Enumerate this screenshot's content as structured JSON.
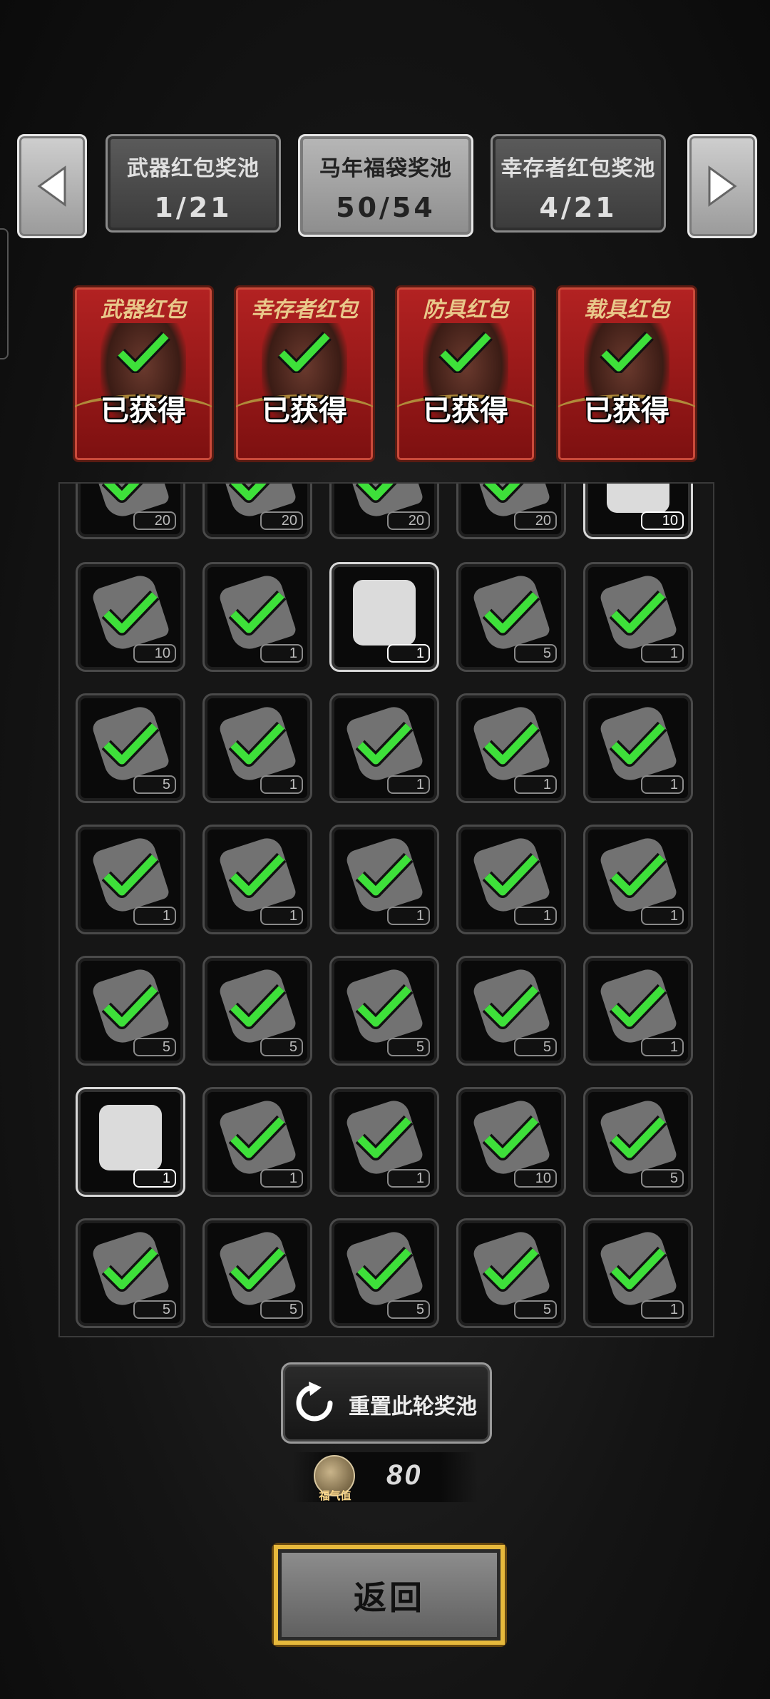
{
  "nav": {
    "prev_icon": "left-triangle-icon",
    "next_icon": "right-triangle-icon"
  },
  "tabs": [
    {
      "name": "武器红包奖池",
      "count": "1/21",
      "active": false
    },
    {
      "name": "马年福袋奖池",
      "count": "50/54",
      "active": true
    },
    {
      "name": "幸存者红包奖池",
      "count": "4/21",
      "active": false
    }
  ],
  "envelopes": [
    {
      "title": "武器红包",
      "status": "已获得"
    },
    {
      "title": "幸存者红包",
      "status": "已获得"
    },
    {
      "title": "防具红包",
      "status": "已获得"
    },
    {
      "title": "载具红包",
      "status": "已获得"
    }
  ],
  "grid": {
    "rows": [
      [
        "20",
        "20",
        "20",
        "20",
        "10"
      ],
      [
        "10",
        "1",
        "1",
        "5",
        "1"
      ],
      [
        "5",
        "1",
        "1",
        "1",
        "1"
      ],
      [
        "1",
        "1",
        "1",
        "1",
        "1"
      ],
      [
        "5",
        "5",
        "5",
        "5",
        "1"
      ],
      [
        "1",
        "1",
        "1",
        "10",
        "5"
      ],
      [
        "5",
        "5",
        "5",
        "5",
        "1"
      ]
    ],
    "unchecked": [
      "0-4",
      "1-2",
      "5-0"
    ]
  },
  "colors": {
    "check_green": "#3ee03a",
    "envelope_red": "#a81d1d",
    "gold_frame": "#e7b93c"
  },
  "reset": {
    "label": "重置此轮奖池",
    "icon": "refresh-icon"
  },
  "luck": {
    "caption": "福气值",
    "value": "80",
    "icon": "luck-coin-icon"
  },
  "back": {
    "label": "返回"
  }
}
